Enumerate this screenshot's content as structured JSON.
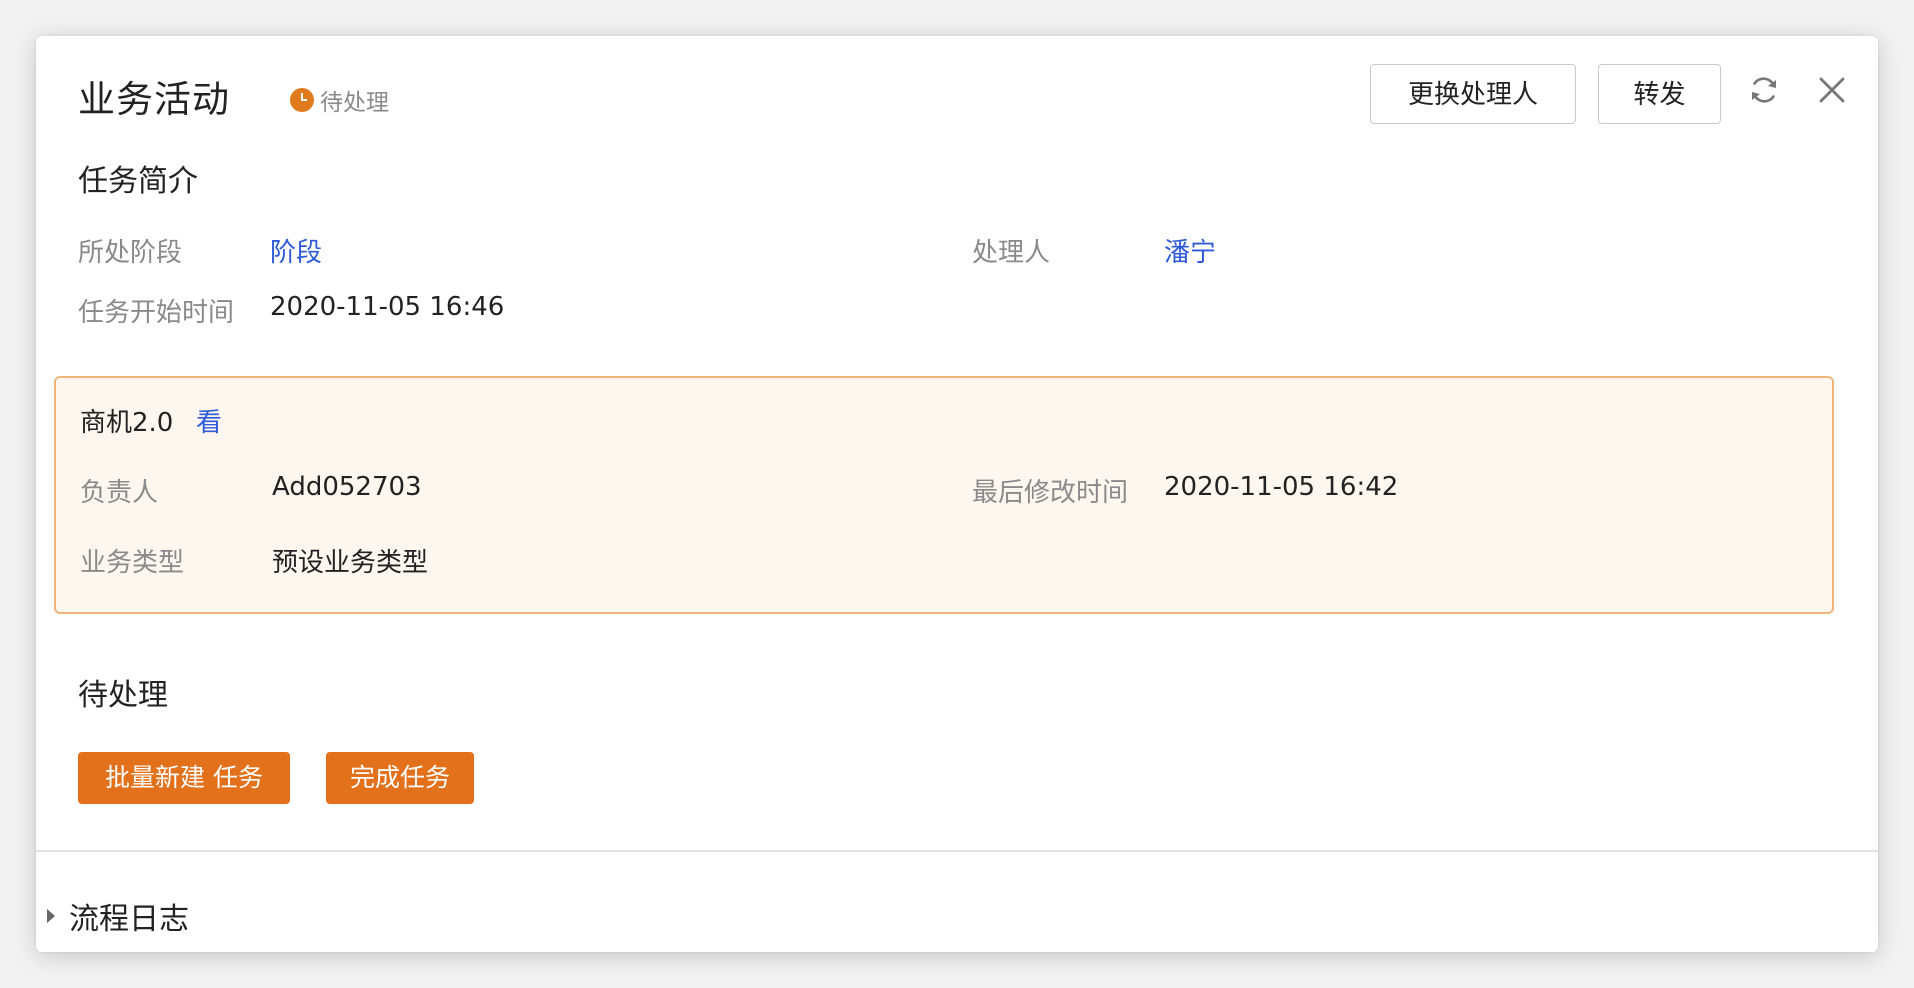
{
  "header": {
    "title": "业务活动",
    "status": "待处理",
    "change_handler_label": "更换处理人",
    "forward_label": "转发"
  },
  "colors": {
    "accent_orange": "#e3701b",
    "link_blue": "#2f5bd8",
    "card_border": "#f1b479",
    "card_bg": "#fdf7f0"
  },
  "intro": {
    "title": "任务简介",
    "stage_label": "所处阶段",
    "stage_value": "阶段",
    "handler_label": "处理人",
    "handler_value": "潘宁",
    "start_time_label": "任务开始时间",
    "start_time_value": "2020-11-05 16:46"
  },
  "card": {
    "title": "商机2.0",
    "view_link": "看",
    "owner_label": "负责人",
    "owner_value": "Add052703",
    "modified_label": "最后修改时间",
    "modified_value": "2020-11-05 16:42",
    "biz_type_label": "业务类型",
    "biz_type_value": "预设业务类型"
  },
  "pending": {
    "title": "待处理",
    "batch_create_label": "批量新建 任务",
    "complete_label": "完成任务"
  },
  "log": {
    "title": "流程日志"
  },
  "icons": {
    "status": "clock-icon",
    "refresh": "refresh-icon",
    "close": "close-icon",
    "expand": "caret-right-icon"
  }
}
